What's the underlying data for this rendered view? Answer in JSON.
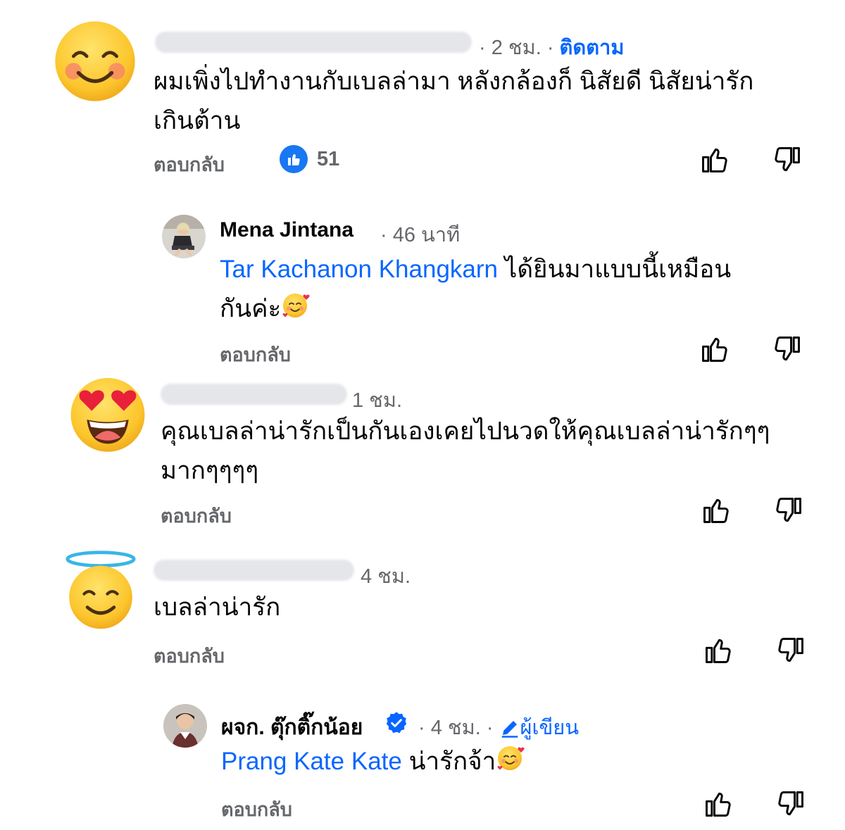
{
  "comments": [
    {
      "time": "· 2 ชม. ·",
      "follow": "ติดตาม",
      "text_line1": "ผมเพิ่งไปทำงานกับเบลล่ามา หลังกล้องก็ นิสัยดี นิสัยน่ารัก",
      "text_line2": "เกินต้าน",
      "reply": "ตอบกลับ",
      "reaction_count": "51",
      "avatar": "smiling-blush-emoji"
    },
    {
      "name": "Mena Jintana",
      "time": "· 46 นาที",
      "mention": "Tar Kachanon Khangkarn",
      "text_line1": " ได้ยินมาแบบนี้เหมือน",
      "text_line2": "กันค่ะ",
      "reply": "ตอบกลับ"
    },
    {
      "time": "1 ชม.",
      "text_line1": "คุณเบลล่าน่ารักเป็นกันเองเคยไปนวดให้คุณเบลล่าน่ารักๆๆ",
      "text_line2": "มากๆๆๆๆ",
      "reply": "ตอบกลับ",
      "avatar": "heart-eyes-emoji"
    },
    {
      "time": "4 ชม.",
      "text_line1": "เบลล่าน่ารัก",
      "reply": "ตอบกลับ",
      "avatar": "halo-emoji"
    },
    {
      "name": "ผจก. ตุ๊กติ๊กน้อย",
      "time": "· 4 ชม. ·",
      "author_tag": "ผู้เขียน",
      "mention": "Prang Kate Kate",
      "text_line1": " น่ารักจ้า",
      "reply": "ตอบกลับ"
    }
  ],
  "colors": {
    "link": "#0866ff",
    "meta": "#65676b",
    "text": "#050505"
  }
}
